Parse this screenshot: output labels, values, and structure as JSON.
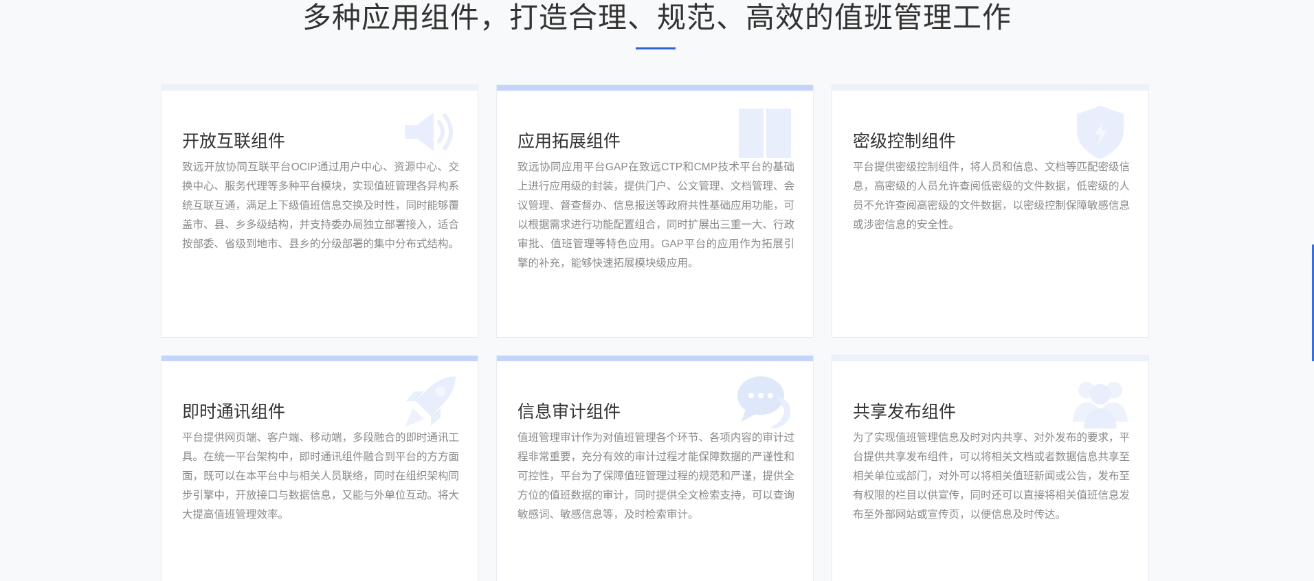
{
  "section": {
    "title": "多种应用组件，打造合理、规范、高效的值班管理工作"
  },
  "colors": {
    "accent": "#2f62d6",
    "topbar_active": "#c5d4fb",
    "topbar_inactive": "#edf1fb",
    "icon_tint": "#e9eefc"
  },
  "cards": [
    {
      "icon": "speaker-icon",
      "title": "开放互联组件",
      "desc": "致远开放协同互联平台OCIP通过用户中心、资源中心、交换中心、服务代理等多种平台模块，实现值班管理各异构系统互联互通，满足上下级值班信息交换及时性，同时能够覆盖市、县、乡多级结构，并支持委办局独立部署接入，适合按部委、省级到地市、县乡的分级部署的集中分布式结构。"
    },
    {
      "icon": "book-icon",
      "title": "应用拓展组件",
      "desc": "致远协同应用平台GAP在致远CTP和CMP技术平台的基础上进行应用级的封装，提供门户、公文管理、文档管理、会议管理、督查督办、信息报送等政府共性基础应用功能，可以根据需求进行功能配置组合，同时扩展出三重一大、行政审批、值班管理等特色应用。GAP平台的应用作为拓展引擎的补充，能够快速拓展模块级应用。"
    },
    {
      "icon": "shield-icon",
      "title": "密级控制组件",
      "desc": "平台提供密级控制组件，将人员和信息、文档等匹配密级信息，高密级的人员允许查阅低密级的文件数据，低密级的人员不允许查阅高密级的文件数据，以密级控制保障敏感信息或涉密信息的安全性。"
    },
    {
      "icon": "rocket-icon",
      "title": "即时通讯组件",
      "desc": "平台提供网页端、客户端、移动端，多段融合的即时通讯工具。在统一平台架构中，即时通讯组件融合到平台的方方面面，既可以在本平台中与相关人员联络，同时在组织架构同步引擎中，开放接口与数据信息，又能与外单位互动。将大大提高值班管理效率。"
    },
    {
      "icon": "chat-icon",
      "title": "信息审计组件",
      "desc": "值班管理审计作为对值班管理各个环节、各项内容的审计过程非常重要，充分有效的审计过程才能保障数据的严谨性和可控性，平台为了保障值班管理过程的规范和严谨，提供全方位的值班数据的审计，同时提供全文检索支持，可以查询敏感词、敏感信息等，及时检索审计。"
    },
    {
      "icon": "users-icon",
      "title": "共享发布组件",
      "desc": "为了实现值班管理信息及时对内共享、对外发布的要求，平台提供共享发布组件，可以将相关文档或者数据信息共享至相关单位或部门，对外可以将相关值班新闻或公告，发布至有权限的栏目以供宣传，同时还可以直接将相关值班信息发布至外部网站或宣传页，以便信息及时传达。"
    }
  ]
}
